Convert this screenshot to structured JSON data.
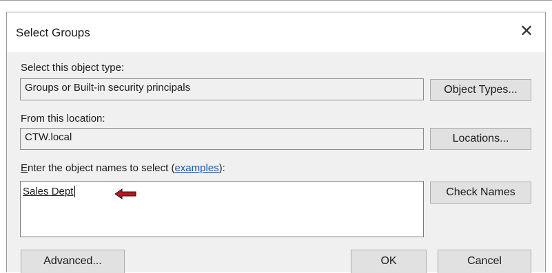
{
  "dialog": {
    "title": "Select Groups",
    "close_glyph": "✕",
    "object_type": {
      "label": "Select this object type:",
      "value": "Groups or Built-in security principals",
      "button": "Object Types..."
    },
    "location": {
      "label": "From this location:",
      "value": "CTW.local",
      "button": "Locations..."
    },
    "names": {
      "label_accel": "E",
      "label_pre": "nter the object names to select (",
      "label_link": "examples",
      "label_post": "):",
      "value": "Sales Dept",
      "check_button": "Check Names"
    },
    "buttons": {
      "advanced": "Advanced...",
      "ok": "OK",
      "cancel": "Cancel"
    }
  },
  "colors": {
    "annotation_arrow": "#c0161b",
    "link": "#0a5bc4"
  },
  "icons": {
    "close": "close-icon",
    "annotation": "left-arrow-icon"
  }
}
